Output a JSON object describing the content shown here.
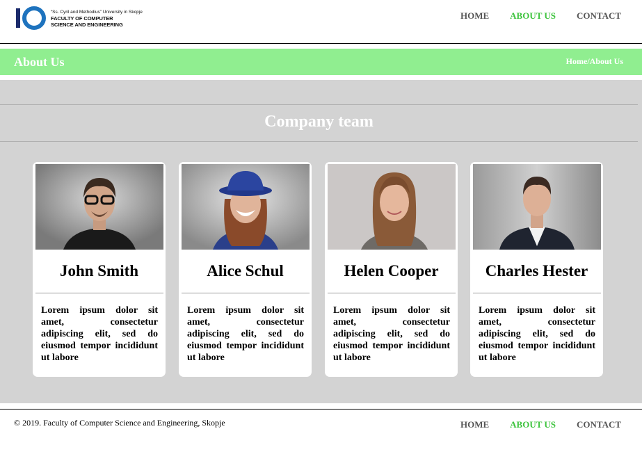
{
  "header": {
    "logo": {
      "university": "“Ss. Cyril and Methodius” University in Skopje",
      "faculty_line1": "FACULTY OF COMPUTER",
      "faculty_line2": "SCIENCE AND ENGINEERING",
      "mark": "IO"
    },
    "nav": [
      {
        "label": "HOME",
        "active": false
      },
      {
        "label": "ABOUT US",
        "active": true
      },
      {
        "label": "CONTACT",
        "active": false
      }
    ]
  },
  "banner": {
    "title": "About Us",
    "breadcrumb": "Home/About Us"
  },
  "team": {
    "heading": "Company team",
    "members": [
      {
        "name": "John Smith",
        "description": "Lorem ipsum dolor sit amet, consectetur adipiscing elit, sed do eiusmod tempor incididunt ut labore"
      },
      {
        "name": "Alice Schul",
        "description": "Lorem ipsum dolor sit amet, consectetur adipiscing elit, sed do eiusmod tempor incididunt ut labore"
      },
      {
        "name": "Helen Cooper",
        "description": "Lorem ipsum dolor sit amet, consectetur adipiscing elit, sed do eiusmod tempor incididunt ut labore"
      },
      {
        "name": "Charles Hester",
        "description": "Lorem ipsum dolor sit amet, consectetur adipiscing elit, sed do eiusmod tempor incididunt ut labore"
      }
    ]
  },
  "footer": {
    "copyright": "© 2019. Faculty of Computer Science and Engineering, Skopje",
    "nav": [
      {
        "label": "HOME",
        "active": false
      },
      {
        "label": "ABOUT US",
        "active": true
      },
      {
        "label": "CONTACT",
        "active": false
      }
    ]
  },
  "colors": {
    "accent": "#90ee90",
    "active_link": "#3ec43e",
    "section_bg": "#d3d3d3",
    "logo_blue": "#1e73be",
    "logo_navy": "#1b2a6b"
  }
}
